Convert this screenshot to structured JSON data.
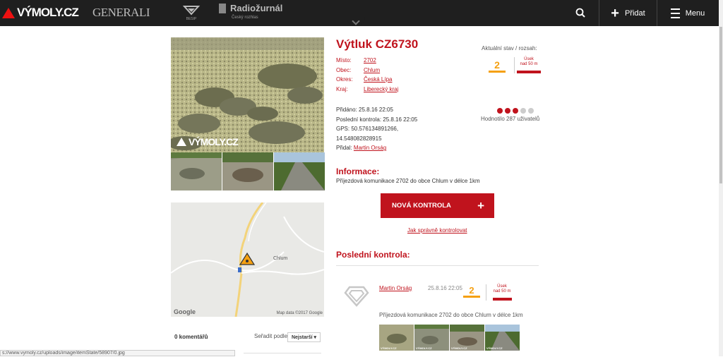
{
  "header": {
    "logo": "VÝMOLY.CZ",
    "partners": [
      "GENERALI",
      "BESIP",
      "Radiožurnál",
      "Český rozhlas"
    ],
    "add_label": "Přidat",
    "menu_label": "Menu"
  },
  "pothole": {
    "title": "Výtluk CZ6730",
    "fields": [
      {
        "key": "Místo:",
        "value": "2702"
      },
      {
        "key": "Obec:",
        "value": "Chlum"
      },
      {
        "key": "Okres:",
        "value": "Česká Lípa"
      },
      {
        "key": "Kraj:",
        "value": "Liberecký kraj"
      }
    ],
    "added": "Přidáno: 25.8.16 22:05",
    "last_check": "Poslední kontrola: 25.8.16 22:05",
    "gps_line1": "GPS: 50.576134891266,",
    "gps_line2": "14.548082828915",
    "added_by_label": "Přidal:",
    "added_by": "Martin Orság",
    "photo_watermark": "VÝMOLY.CZ"
  },
  "state": {
    "label": "Aktuální stav / rozsah:",
    "value": "2",
    "usek_line1": "Úsek",
    "usek_line2": "nad 50 m",
    "color": "#f5a011"
  },
  "rating": {
    "filled": 3,
    "total": 5,
    "text": "Hodnotilo 287 uživatelů"
  },
  "information": {
    "heading": "Informace:",
    "text": "Příjezdová komunikace 2702 do obce Chlum v délce 1km"
  },
  "cta": {
    "label": "NOVÁ KONTROLA",
    "help_link": "Jak správně kontrolovat"
  },
  "last_check_section": {
    "heading": "Poslední kontrola:",
    "author": "Martin Orság",
    "date": "25.8.16 22:05",
    "value": "2",
    "usek_line1": "Úsek",
    "usek_line2": "nad 50 m",
    "text": "Příjezdová komunikace 2702 do obce Chlum v délce 1km",
    "thumb_label": "VÝMOLY.CZ"
  },
  "map": {
    "place": "Chlum",
    "google": "Google",
    "attribution": "Map data ©2017 Google"
  },
  "comments": {
    "count_label": "0 komentářů",
    "sort_label": "Seřadit podle",
    "sort_value": "Nejstarší ▾"
  },
  "statusbar": {
    "url": "s://www.vymoly.cz/uploads/image/itemState/58907/0.jpg"
  },
  "colors": {
    "brand_red": "#c0131d",
    "header_bg": "#1f1f1f",
    "rating_off": "#cccccc"
  }
}
